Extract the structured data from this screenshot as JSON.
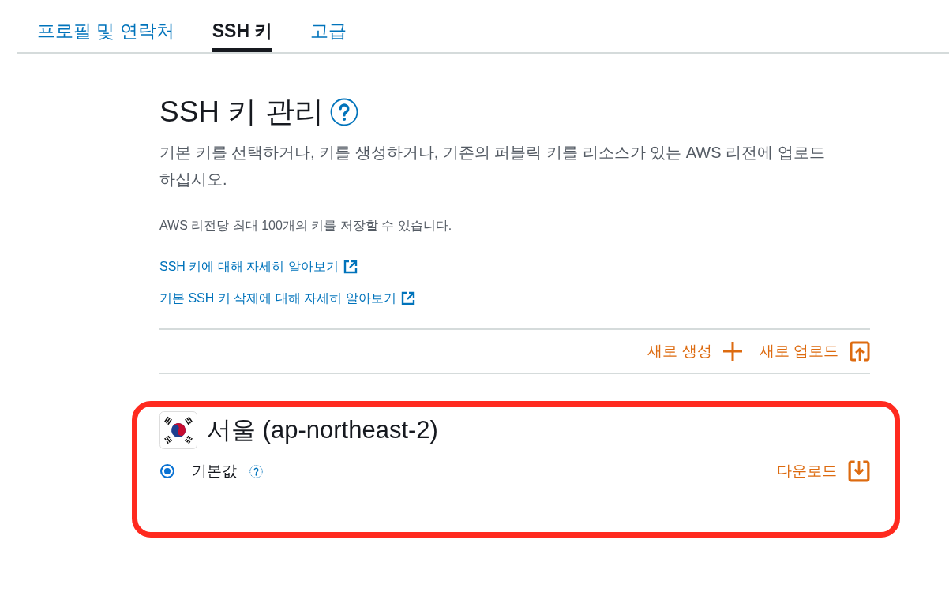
{
  "tabs": [
    {
      "label": "프로필 및 연락처",
      "selected": false
    },
    {
      "label": "SSH 키",
      "selected": true
    },
    {
      "label": "고급",
      "selected": false
    }
  ],
  "header": {
    "title": "SSH 키 관리",
    "description": "기본 키를 선택하거나, 키를 생성하거나, 기존의 퍼블릭 키를 리소스가 있는 AWS 리전에 업로드하십시오.",
    "limit_note": "AWS 리전당 최대 100개의 키를 저장할 수 있습니다."
  },
  "links": [
    "SSH 키에 대해 자세히 알아보기",
    "기본 SSH 키 삭제에 대해 자세히 알아보기"
  ],
  "actions": [
    {
      "label": "새로 생성",
      "kind": "create"
    },
    {
      "label": "새로 업로드",
      "kind": "upload"
    }
  ],
  "regions": [
    {
      "name": "서울 (ap-northeast-2)",
      "highlighted": true,
      "keys": [
        {
          "label": "기본값",
          "selected": true,
          "download_label": "다운로드"
        }
      ]
    }
  ]
}
